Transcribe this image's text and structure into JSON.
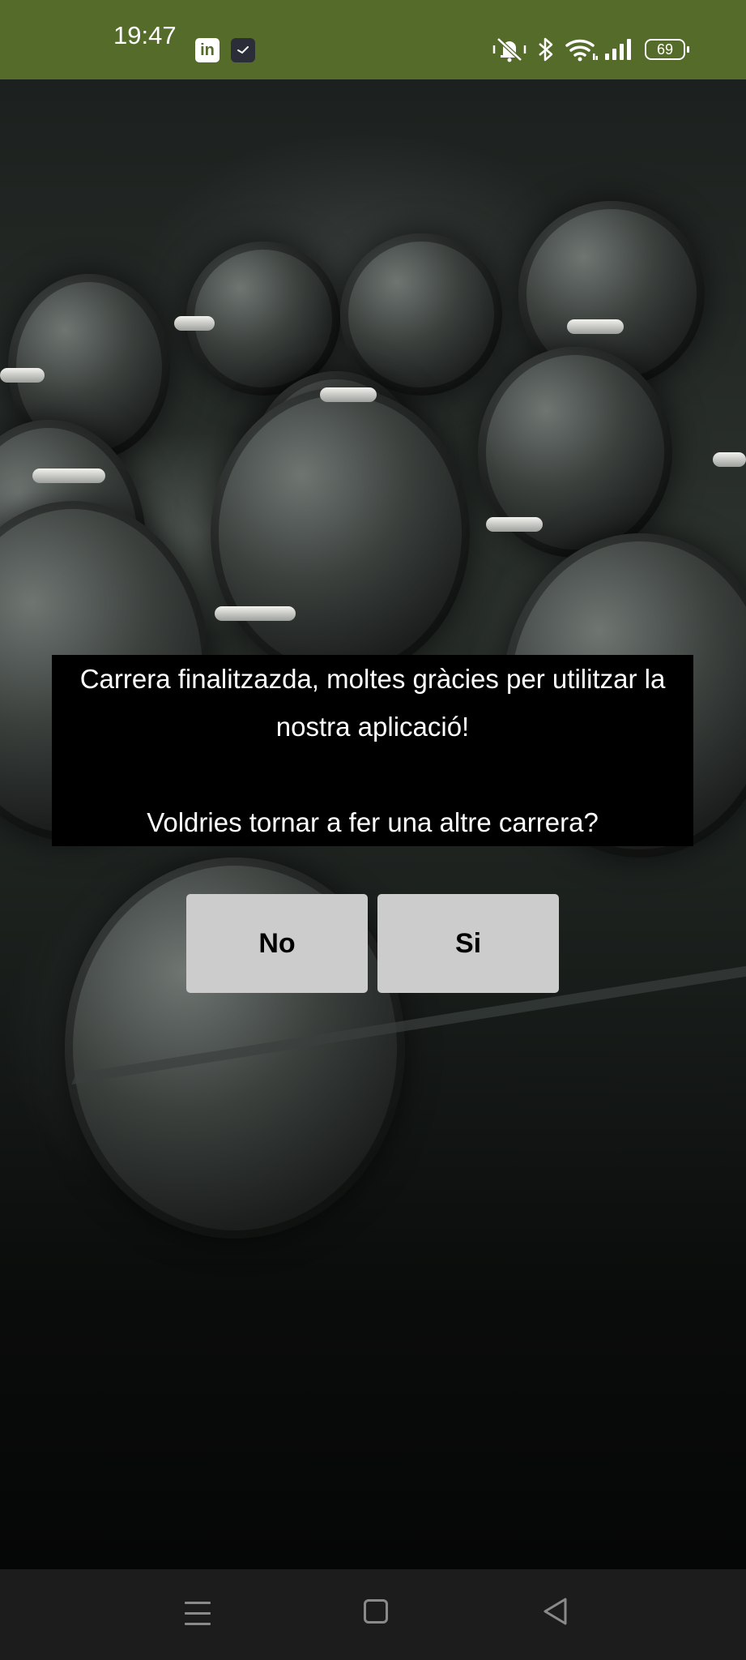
{
  "status_bar": {
    "time": "19:47",
    "linkedin_glyph": "in",
    "battery_level": "69",
    "icons": [
      "linkedin-icon",
      "clock-app-icon",
      "bell-off-icon",
      "bluetooth-icon",
      "wifi-icon",
      "signal-icon",
      "battery-icon"
    ],
    "background_color": "#556b2a"
  },
  "dialog": {
    "message_line": "Carrera finalitzazda, moltes gràcies per utilitzar la nostra aplicació!",
    "question": "Voldries tornar a fer una altre carrera?",
    "buttons": {
      "no_label": "No",
      "si_label": "Si"
    },
    "button_color": "#cccccc"
  },
  "nav_bar": {
    "icons": [
      "menu-icon",
      "home-icon",
      "back-icon"
    ]
  }
}
